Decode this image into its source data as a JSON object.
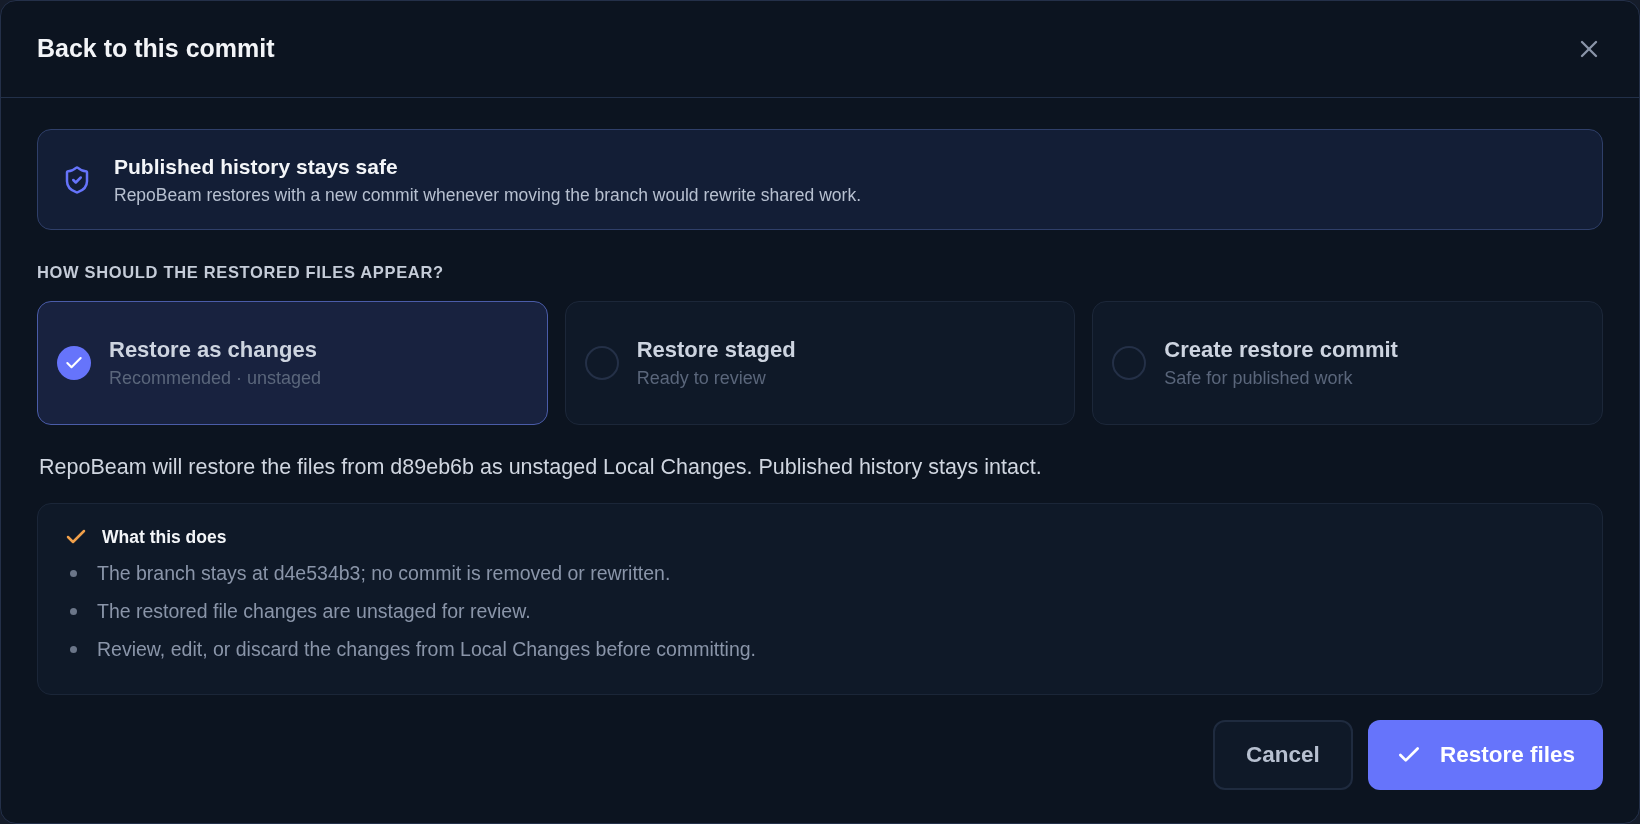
{
  "dialog": {
    "title": "Back to this commit"
  },
  "notice": {
    "title": "Published history stays safe",
    "text": "RepoBeam restores with a new commit whenever moving the branch would rewrite shared work."
  },
  "section_label": "HOW SHOULD THE RESTORED FILES APPEAR?",
  "options": [
    {
      "title": "Restore as changes",
      "subtitle": "Recommended · unstaged",
      "selected": true
    },
    {
      "title": "Restore staged",
      "subtitle": "Ready to review",
      "selected": false
    },
    {
      "title": "Create restore commit",
      "subtitle": "Safe for published work",
      "selected": false
    }
  ],
  "summary": "RepoBeam will restore the files from d89eb6b as unstaged Local Changes. Published history stays intact.",
  "details": {
    "title": "What this does",
    "items": [
      "The branch stays at d4e534b3; no commit is removed or rewritten.",
      "The restored file changes are unstaged for review.",
      "Review, edit, or discard the changes from Local Changes before committing."
    ]
  },
  "buttons": [
    {
      "label": "Cancel",
      "kind": "secondary"
    },
    {
      "label": "Restore files",
      "kind": "primary"
    }
  ]
}
